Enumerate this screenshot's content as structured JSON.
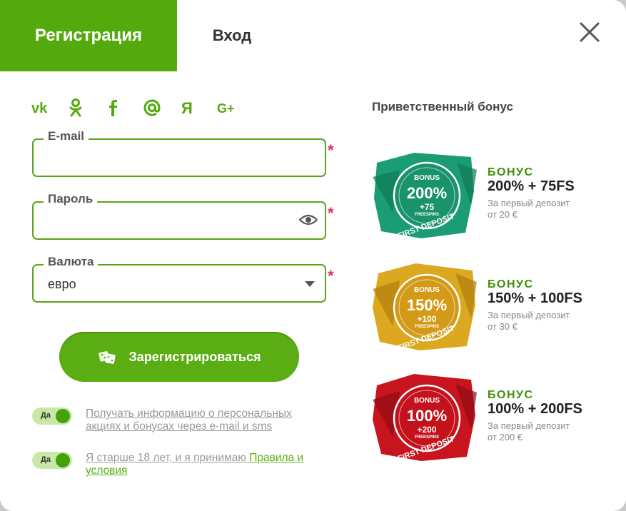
{
  "tabs": {
    "register": "Регистрация",
    "login": "Вход"
  },
  "social": [
    "vk",
    "ok",
    "f",
    "@",
    "Я",
    "G+"
  ],
  "form": {
    "email_label": "E-mail",
    "email_value": "",
    "password_label": "Пароль",
    "password_value": "",
    "currency_label": "Валюта",
    "currency_value": "евро",
    "required_mark": "*",
    "register_button": "Зарегистрироваться"
  },
  "toggles": [
    {
      "state": "Да",
      "text": "Получать информацию о персональных акциях и бонусах через e-mail и sms"
    },
    {
      "state": "Да",
      "text": "Я старше 18 лет, и я принимаю ",
      "link": "Правила и условия"
    }
  ],
  "bonus": {
    "heading": "Приветственный бонус",
    "items": [
      {
        "badge_top": "BONUS",
        "badge_pct": "200%",
        "badge_fs": "+75",
        "badge_fs_label": "FREESPINS",
        "badge_ribbon": "FIRST DEPOSIT",
        "title": "БОНУС",
        "value": "200% + 75FS",
        "line1": "За первый депозит",
        "line2": "от 20 €",
        "color": "#1a9d74"
      },
      {
        "badge_top": "BONUS",
        "badge_pct": "150%",
        "badge_fs": "+100",
        "badge_fs_label": "FREESPINS",
        "badge_ribbon": "FIRST DEPOSIT",
        "title": "БОНУС",
        "value": "150% + 100FS",
        "line1": "За первый депозит",
        "line2": "от 30 €",
        "color": "#d9a520"
      },
      {
        "badge_top": "BONUS",
        "badge_pct": "100%",
        "badge_fs": "+200",
        "badge_fs_label": "FREESPINS",
        "badge_ribbon": "FIRST DEPOSIT",
        "title": "БОНУС",
        "value": "100% + 200FS",
        "line1": "За первый депозит",
        "line2": "от 200 €",
        "color": "#c8141e"
      }
    ]
  },
  "colors": {
    "accent": "#54a90d",
    "required": "#e4325a",
    "link": "#5aae13"
  }
}
